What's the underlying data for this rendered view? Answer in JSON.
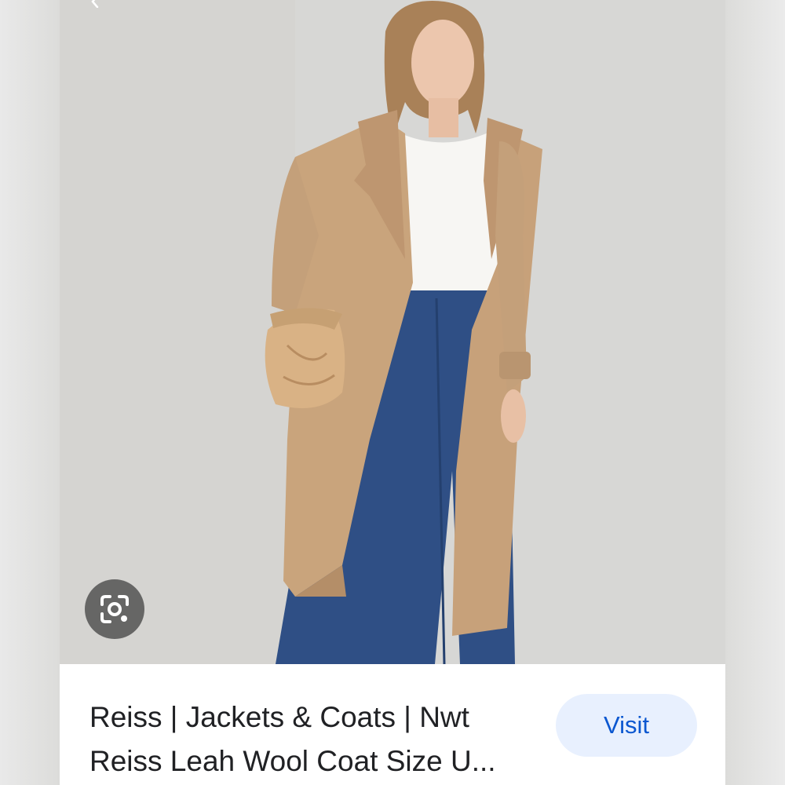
{
  "result": {
    "title_line1": "Reiss | Jackets & Coats | Nwt",
    "title_line2": "Reiss Leah Wool Coat Size U...",
    "visit_label": "Visit"
  },
  "image": {
    "alt": "Woman wearing a camel wool coat, white top and blue flared jeans, holding a tan pouch bag"
  },
  "icons": {
    "back": "chevron-left-icon",
    "lens": "google-lens-icon"
  },
  "colors": {
    "visit_bg": "#e8f0fe",
    "visit_text": "#0b57d0",
    "title_text": "#202124",
    "lens_button_bg": "#464646",
    "coat": "#c9a47c",
    "jeans": "#2f4f85"
  }
}
